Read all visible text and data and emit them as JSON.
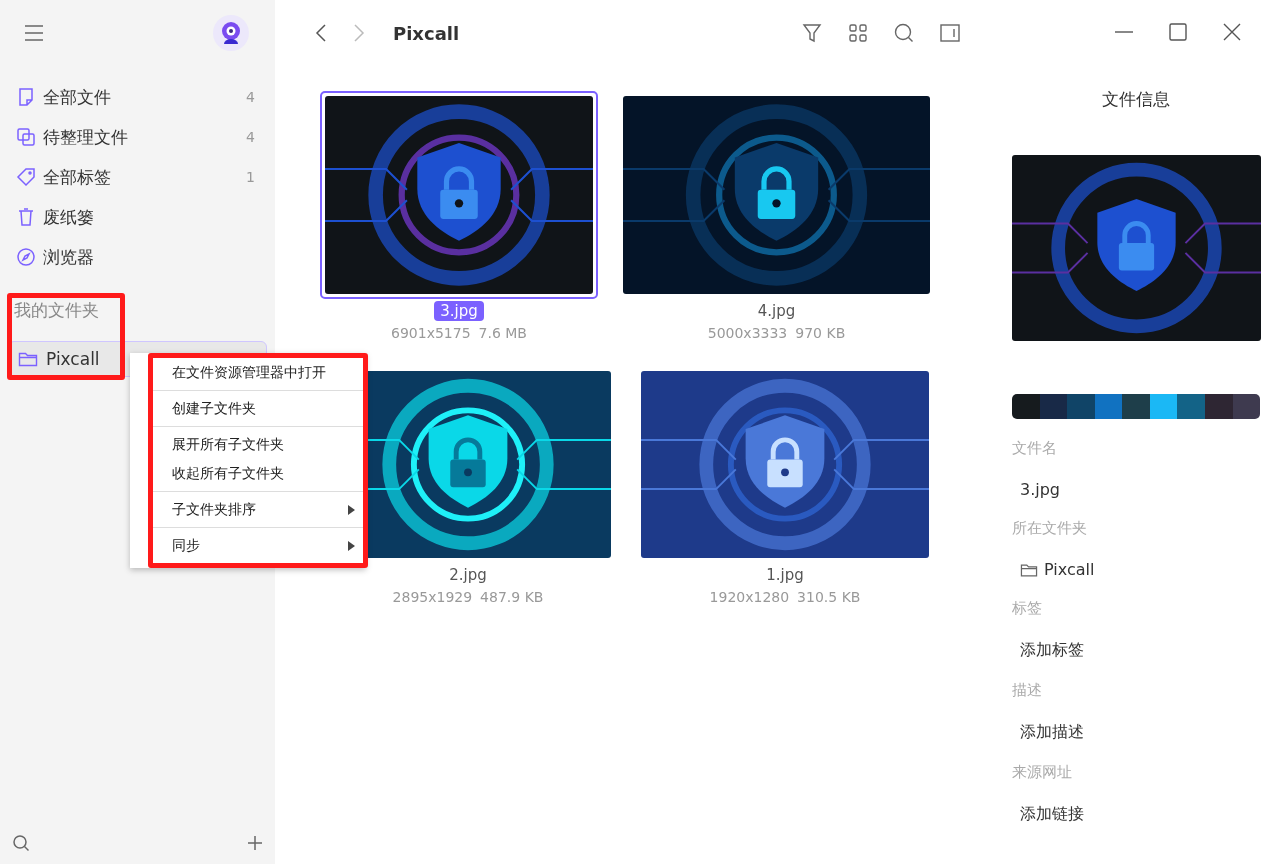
{
  "toolbar": {
    "title": "Pixcall"
  },
  "sidebar": {
    "items": [
      {
        "label": "全部文件",
        "count": "4",
        "kind": "file"
      },
      {
        "label": "待整理文件",
        "count": "4",
        "kind": "copy"
      },
      {
        "label": "全部标签",
        "count": "1",
        "kind": "tag"
      },
      {
        "label": "废纸篓",
        "kind": "trash"
      },
      {
        "label": "浏览器",
        "kind": "compass"
      }
    ],
    "section_title": "我的文件夹",
    "folders": [
      {
        "label": "Pixcall",
        "selected": true
      }
    ]
  },
  "context_menu": {
    "groups": [
      [
        {
          "label": "在文件资源管理器中打开",
          "has_submenu": false
        }
      ],
      [
        {
          "label": "创建子文件夹",
          "has_submenu": false
        }
      ],
      [
        {
          "label": "展开所有子文件夹",
          "has_submenu": false
        },
        {
          "label": "收起所有子文件夹",
          "has_submenu": false
        }
      ],
      [
        {
          "label": "子文件夹排序",
          "has_submenu": true
        }
      ],
      [
        {
          "label": "同步",
          "has_submenu": true
        }
      ]
    ]
  },
  "files": [
    {
      "name": "3.jpg",
      "dimensions": "6901x5175",
      "size": "7.6 MB",
      "selected": true,
      "kind": "picture"
    },
    {
      "name": "4.jpg",
      "dimensions": "5000x3333",
      "size": "970 KB",
      "selected": false,
      "kind": "picture"
    },
    {
      "name": "2.jpg",
      "dimensions": "2895x1929",
      "size": "487.9 KB",
      "selected": false,
      "kind": "picture"
    },
    {
      "name": "1.jpg",
      "dimensions": "1920x1280",
      "size": "310.5 KB",
      "selected": false,
      "kind": "picture"
    }
  ],
  "info_panel": {
    "title": "文件信息",
    "palette": [
      {
        "color": "#161b1e"
      },
      {
        "color": "#182947"
      },
      {
        "color": "#104467"
      },
      {
        "color": "#1172c1"
      },
      {
        "color": "#1e3e4a"
      },
      {
        "color": "#1bb8f5"
      },
      {
        "color": "#136387"
      },
      {
        "color": "#2e2633"
      },
      {
        "color": "#3e3a4f"
      }
    ],
    "fields": [
      {
        "label": "文件名",
        "value": "3.jpg",
        "kind": "text"
      },
      {
        "label": "所在文件夹",
        "value": "Pixcall",
        "kind": "folder"
      },
      {
        "label": "标签",
        "value": "添加标签",
        "kind": "text"
      },
      {
        "label": "描述",
        "value": "添加描述",
        "kind": "text"
      },
      {
        "label": "来源网址",
        "value": "添加链接",
        "kind": "text"
      }
    ]
  }
}
